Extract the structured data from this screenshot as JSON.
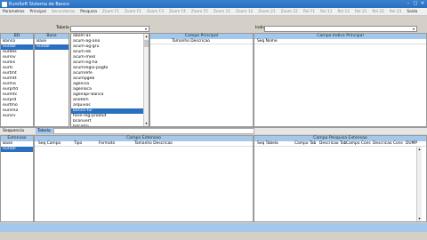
{
  "window": {
    "title": "EuroSoft Sistema de Banco",
    "min": "–",
    "max": "□",
    "close": "✕"
  },
  "menu": [
    {
      "label": "Parametros",
      "dim": false
    },
    {
      "label": "Principal",
      "dim": false
    },
    {
      "label": "Secundarias",
      "dim": true
    },
    {
      "label": "Pesquisa",
      "dim": false
    },
    {
      "label": "Zoom F1",
      "dim": true
    },
    {
      "label": "Zoom F1",
      "dim": true
    },
    {
      "label": "Zoom F3",
      "dim": true
    },
    {
      "label": "Zoom F4",
      "dim": true
    },
    {
      "label": "Zoom F5",
      "dim": true
    },
    {
      "label": "Zoom 11",
      "dim": true
    },
    {
      "label": "Zoom 12",
      "dim": true
    },
    {
      "label": "Zoom 21",
      "dim": true
    },
    {
      "label": "Zoom 22",
      "dim": true
    },
    {
      "label": "Rel F1",
      "dim": true
    },
    {
      "label": "Rel 11",
      "dim": true
    },
    {
      "label": "Rel 12",
      "dim": true
    },
    {
      "label": "Rel 21",
      "dim": true
    },
    {
      "label": "Rel 22",
      "dim": true
    },
    {
      "label": "Rel 23",
      "dim": true
    },
    {
      "label": "Saida",
      "dim": false
    }
  ],
  "tabela": {
    "label": "Tabela",
    "value": ""
  },
  "indice": {
    "label": "Indice",
    "value": ""
  },
  "bd": {
    "header": "BD",
    "items": [
      "Banco",
      "eurobr",
      "eurdes",
      "eurinv",
      "eurdis",
      "eurfc",
      "eurtmt",
      "eurmtt",
      "eurmo",
      "eurprtd",
      "eurmtc",
      "eurprd",
      "eurtmo",
      "eursmo",
      "eursrv"
    ],
    "selected": 1
  },
  "base": {
    "header": "Base",
    "items": [
      "Base",
      "eurobr"
    ],
    "selected": 1
  },
  "dropdown": {
    "items": [
      "abom-as",
      "acum-ag-ano",
      "acum-ag-gru",
      "acum-eb",
      "acum-mesl",
      "acum-eg-ha",
      "acumregio-pagto",
      "acumrefe",
      "acumpgeb",
      "agencia",
      "agenloca",
      "agenapr-banco",
      "anotem",
      "arquivos",
      "banco-ful",
      "fone-reg-prodlut",
      "bconvert",
      "bdcarto",
      "bloqueados",
      "bloqsaldos"
    ],
    "selected": 14
  },
  "campo_principal": {
    "header": "Campo Principal",
    "col": "Tamanho Descricao"
  },
  "campo_indice": {
    "header": "Campo Indice Principal",
    "col": "Seq Nome"
  },
  "sequencia": {
    "label": "Sequencia",
    "tabela_label": "Tabela"
  },
  "extensao": {
    "header": "Extensao",
    "items": [
      "Base",
      "eurobr"
    ],
    "selected": 1
  },
  "campo_extensao": {
    "header": "Campo Extensao",
    "cols": [
      "Seq Campo",
      "Tipo",
      "Formato",
      "Tamanho Descricao"
    ]
  },
  "campo_pesquisa": {
    "header": "Campo Pesquisa Extensao",
    "cols": [
      "Seq Tabela",
      "Campo Tab",
      "Descricao Tab",
      "Campo Cons",
      "Descricao Cons",
      "DUMP"
    ]
  }
}
